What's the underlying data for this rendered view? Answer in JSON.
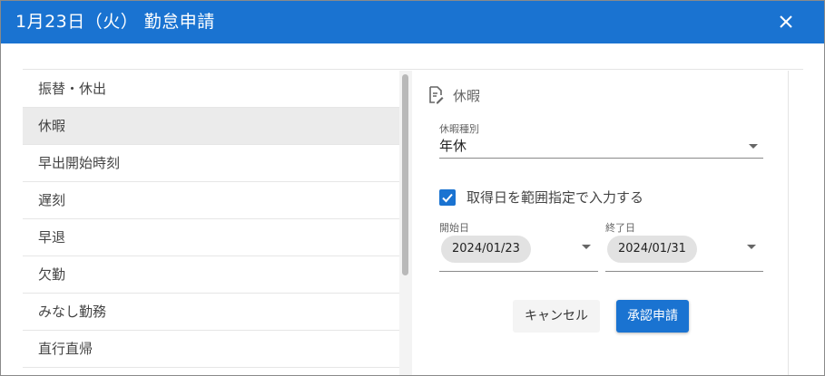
{
  "dialog": {
    "title": "1月23日（火） 勤怠申請",
    "close_icon": "close-icon"
  },
  "list": {
    "items": [
      {
        "label": "振替・休出"
      },
      {
        "label": "休暇"
      },
      {
        "label": "早出開始時刻"
      },
      {
        "label": "遅刻"
      },
      {
        "label": "早退"
      },
      {
        "label": "欠勤"
      },
      {
        "label": "みなし勤務"
      },
      {
        "label": "直行直帰"
      }
    ],
    "selected_index": 1
  },
  "form": {
    "section_title": "休暇",
    "section_icon": "document-edit-icon",
    "leave_type_label": "休暇種別",
    "leave_type_value": "年休",
    "range_checkbox_label": "取得日を範囲指定で入力する",
    "range_checkbox_checked": true,
    "start_label": "開始日",
    "start_value": "2024/01/23",
    "end_label": "終了日",
    "end_value": "2024/01/31",
    "cancel_label": "キャンセル",
    "submit_label": "承認申請"
  },
  "colors": {
    "accent": "#1a73d1",
    "selected_row": "#ebebeb"
  }
}
